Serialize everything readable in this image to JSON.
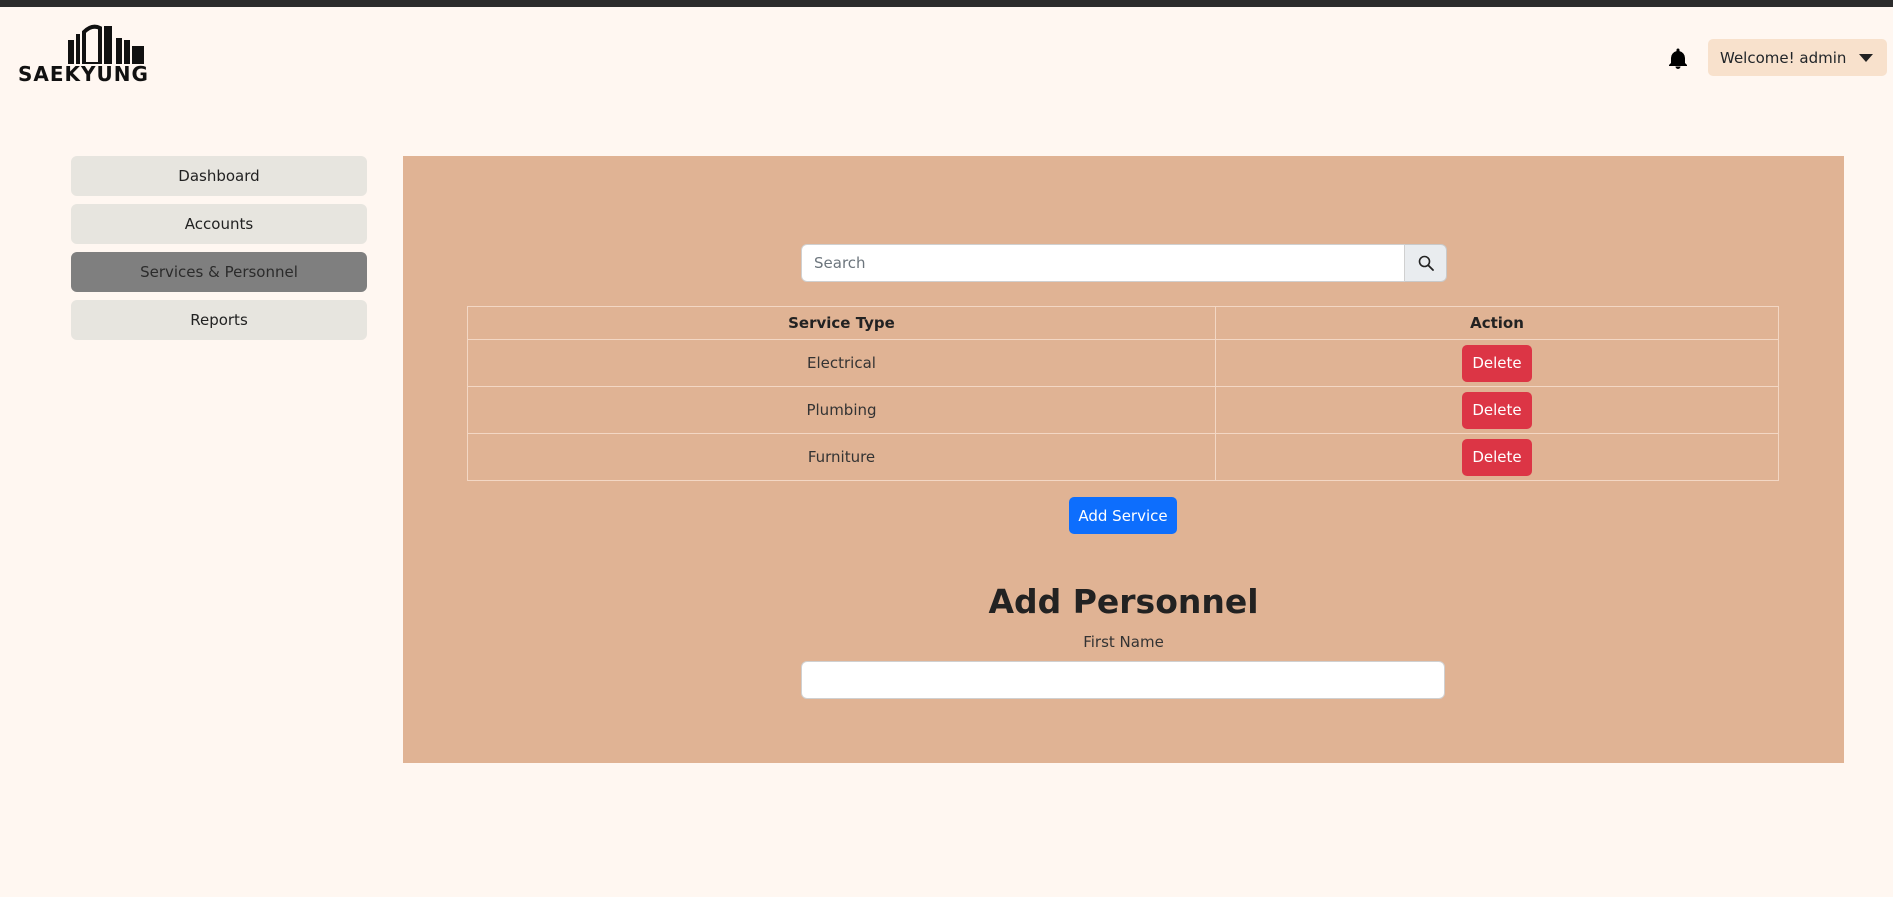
{
  "header": {
    "logo_text": "SAEKYUNG",
    "user_menu_label": "Welcome! admin"
  },
  "sidebar": {
    "items": [
      {
        "label": "Dashboard",
        "active": false
      },
      {
        "label": "Accounts",
        "active": false
      },
      {
        "label": "Services & Personnel",
        "active": true
      },
      {
        "label": "Reports",
        "active": false
      }
    ]
  },
  "search": {
    "placeholder": "Search",
    "value": ""
  },
  "services_table": {
    "columns": [
      "Service Type",
      "Action"
    ],
    "rows": [
      {
        "service_type": "Electrical",
        "action": "Delete"
      },
      {
        "service_type": "Plumbing",
        "action": "Delete"
      },
      {
        "service_type": "Furniture",
        "action": "Delete"
      }
    ]
  },
  "add_service_label": "Add Service",
  "personnel_form": {
    "title": "Add Personnel",
    "first_name_label": "First Name",
    "first_name_value": ""
  },
  "colors": {
    "page_bg": "#fff7f1",
    "panel_bg": "#e0b394",
    "delete": "#dc3545",
    "primary": "#0d6efd",
    "sidebar_active": "#7f7f7f",
    "sidebar_item": "#e7e5df",
    "user_menu_bg": "#f8e1cc"
  },
  "icons": {
    "bell": "bell-icon",
    "search": "search-icon",
    "dropdown": "caret-down-icon"
  }
}
